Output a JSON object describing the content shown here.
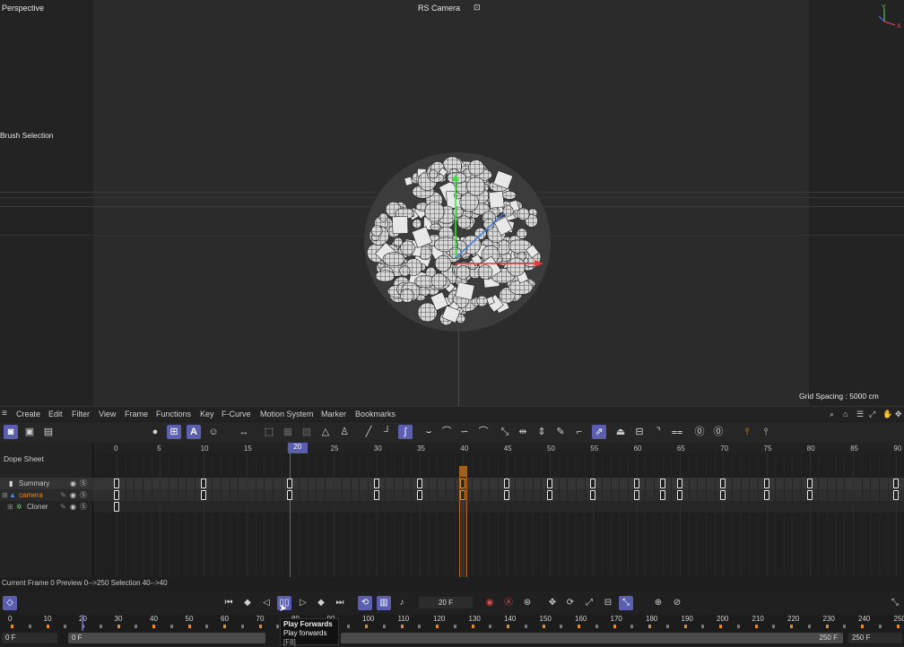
{
  "viewport": {
    "view_name": "Perspective",
    "camera_name": "RS Camera",
    "tool_label": "Brush Selection",
    "grid_spacing": "Grid Spacing : 5000 cm",
    "axis_y": "Y",
    "axis_x": "X"
  },
  "menu": {
    "items": [
      "Create",
      "Edit",
      "Filter",
      "View",
      "Frame",
      "Functions",
      "Key",
      "F-Curve",
      "Motion System",
      "Marker",
      "Bookmarks"
    ]
  },
  "dope": {
    "title": "Dope Sheet",
    "ruler": [
      "0",
      "5",
      "10",
      "15",
      "20",
      "25",
      "30",
      "35",
      "40",
      "45",
      "50",
      "55",
      "60",
      "65",
      "70",
      "75",
      "80",
      "85",
      "90"
    ],
    "tracks": [
      {
        "name": "Summary"
      },
      {
        "name": "camera"
      },
      {
        "name": "Cloner"
      }
    ],
    "current_frame_label": "20"
  },
  "status": {
    "text": "Current Frame  0   Preview  0-->250    Selection 40-->40"
  },
  "transport": {
    "frame_field": "20 F"
  },
  "timeline": {
    "ticks": [
      "0",
      "10",
      "20",
      "30",
      "40",
      "50",
      "60",
      "70",
      "80",
      "90",
      "100",
      "110",
      "120",
      "130",
      "140",
      "150",
      "160",
      "170",
      "180",
      "190",
      "200",
      "210",
      "220",
      "230",
      "240",
      "250"
    ]
  },
  "bottom": {
    "start_a": "0 F",
    "start_b": "0 F",
    "end_a": "250 F",
    "end_b": "250 F"
  },
  "tooltip": {
    "title": "Play Forwards",
    "desc": "Play forwards",
    "shortcut": "[F8]"
  },
  "colors": {
    "accent": "#5a5fb0",
    "key_orange": "#e08a2a",
    "camera_label": "#e08a2a"
  }
}
